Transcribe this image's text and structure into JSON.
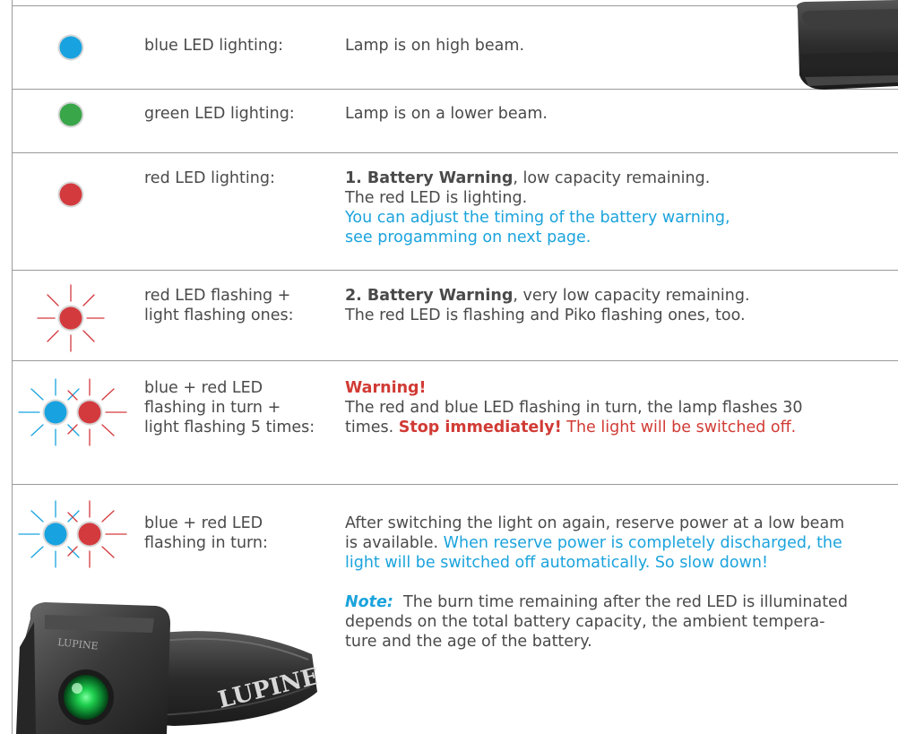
{
  "colors": {
    "blue_led": "#18a3e0",
    "green_led": "#3aa64a",
    "red_led": "#d33a3e",
    "accent_blue_text": "#1ba3dc",
    "warning_red_text": "#d13b35",
    "rule_gray": "#9a9a9a"
  },
  "rows": [
    {
      "label": "blue LED lighting:",
      "description": "Lamp is on high beam.",
      "icon": "blue-led-icon"
    },
    {
      "label": "green LED lighting:",
      "description": "Lamp is on a lower beam.",
      "icon": "green-led-icon"
    },
    {
      "label": "red LED lighting:",
      "icon": "red-led-icon",
      "lead_bold": "1. Battery Warning",
      "lead_rest": ", low capacity remaining.",
      "line2": "The red LED is lighting.",
      "blue_line1": "You can adjust the timing of the battery warning,",
      "blue_line2": "see progamming on next page."
    },
    {
      "label_line1": "red LED flashing +",
      "label_line2": "light flashing ones:",
      "icon": "red-led-flashing-icon",
      "lead_bold": "2. Battery Warning",
      "lead_rest": ", very low capacity remaining.",
      "line2": "The red LED is flashing and Piko flashing ones, too."
    },
    {
      "label_line1": "blue + red LED",
      "label_line2": "flashing in turn +",
      "label_line3": "light flashing 5 times:",
      "icon": "blue-red-led-flashing-icon",
      "warning_heading": "Warning!",
      "line2": "The red and blue LED flashing in turn, the lamp flashes 30",
      "line3_start": "times. ",
      "stop_bold": "Stop immediately!",
      "line3_end": " The light will be switched off."
    },
    {
      "label_line1": "blue + red LED",
      "label_line2": "flashing in turn:",
      "icon": "blue-red-led-flashing-icon",
      "para_line1": "After switching the light on again, reserve power at a low beam",
      "para_line2_gray": "is available. ",
      "para_line2_blue": "When reserve power is completely discharged, the",
      "para_line3_blue": "light will be switched off automatically. So slow down!",
      "note_label": "Note:",
      "note_line1": "  The burn time remaining after the red LED is illuminated",
      "note_line2": "depends on the total battery capacity, the ambient tempera-",
      "note_line3": "ture and the age of the battery."
    }
  ],
  "device": {
    "brand_strap": "LUPINE",
    "brand_housing": "LUPINE"
  }
}
